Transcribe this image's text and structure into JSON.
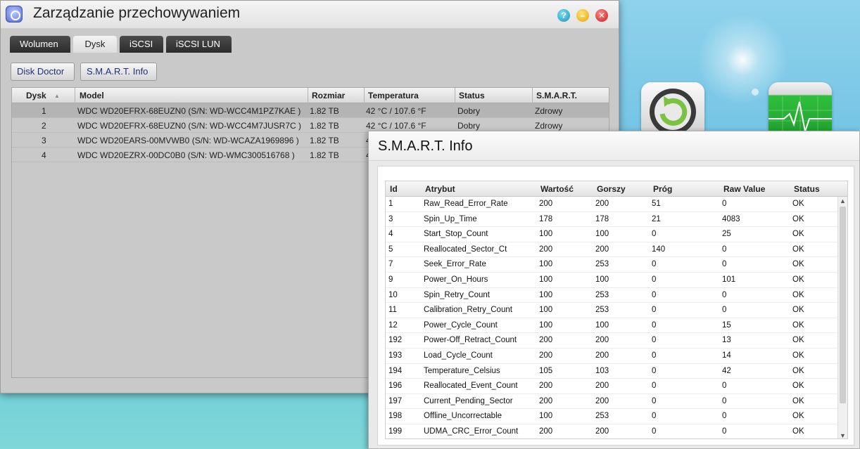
{
  "window": {
    "title": "Zarządzanie przechowywaniem",
    "help_icon": "question-icon",
    "minimize_icon": "minimize-icon",
    "close_icon": "close-icon"
  },
  "tabs": [
    {
      "label": "Wolumen"
    },
    {
      "label": "Dysk"
    },
    {
      "label": "iSCSI"
    },
    {
      "label": "iSCSI LUN"
    }
  ],
  "toolbar": {
    "disk_doctor": "Disk Doctor",
    "smart_info": "S.M.A.R.T. Info"
  },
  "disk_table": {
    "headers": [
      "Dysk",
      "Model",
      "Rozmiar",
      "Temperatura",
      "Status",
      "S.M.A.R.T."
    ],
    "sort_indicator": "▲",
    "rows": [
      {
        "disk": "1",
        "model": "WDC WD20EFRX-68EUZN0 (S/N: WD-WCC4M1PZ7KAE )",
        "size": "1.82 TB",
        "temp": "42 °C / 107.6 °F",
        "status": "Dobry",
        "smart": "Zdrowy"
      },
      {
        "disk": "2",
        "model": "WDC WD20EFRX-68EUZN0 (S/N: WD-WCC4M7JUSR7C )",
        "size": "1.82 TB",
        "temp": "42 °C / 107.6 °F",
        "status": "Dobry",
        "smart": "Zdrowy"
      },
      {
        "disk": "3",
        "model": "WDC WD20EARS-00MVWB0 (S/N: WD-WCAZA1969896 )",
        "size": "1.82 TB",
        "temp": "4",
        "status": "",
        "smart": ""
      },
      {
        "disk": "4",
        "model": "WDC WD20EZRX-00DC0B0 (S/N: WD-WMC300516768 )",
        "size": "1.82 TB",
        "temp": "4",
        "status": "",
        "smart": ""
      }
    ]
  },
  "smart_dialog": {
    "title": "S.M.A.R.T. Info",
    "headers": [
      "Id",
      "Atrybut",
      "Wartość",
      "Gorszy",
      "Próg",
      "Raw Value",
      "Status"
    ],
    "rows": [
      {
        "id": "1",
        "attr": "Raw_Read_Error_Rate",
        "value": "200",
        "worst": "200",
        "thresh": "51",
        "raw": "0",
        "status": "OK"
      },
      {
        "id": "3",
        "attr": "Spin_Up_Time",
        "value": "178",
        "worst": "178",
        "thresh": "21",
        "raw": "4083",
        "status": "OK"
      },
      {
        "id": "4",
        "attr": "Start_Stop_Count",
        "value": "100",
        "worst": "100",
        "thresh": "0",
        "raw": "25",
        "status": "OK"
      },
      {
        "id": "5",
        "attr": "Reallocated_Sector_Ct",
        "value": "200",
        "worst": "200",
        "thresh": "140",
        "raw": "0",
        "status": "OK"
      },
      {
        "id": "7",
        "attr": "Seek_Error_Rate",
        "value": "100",
        "worst": "253",
        "thresh": "0",
        "raw": "0",
        "status": "OK"
      },
      {
        "id": "9",
        "attr": "Power_On_Hours",
        "value": "100",
        "worst": "100",
        "thresh": "0",
        "raw": "101",
        "status": "OK"
      },
      {
        "id": "10",
        "attr": "Spin_Retry_Count",
        "value": "100",
        "worst": "253",
        "thresh": "0",
        "raw": "0",
        "status": "OK"
      },
      {
        "id": "11",
        "attr": "Calibration_Retry_Count",
        "value": "100",
        "worst": "253",
        "thresh": "0",
        "raw": "0",
        "status": "OK"
      },
      {
        "id": "12",
        "attr": "Power_Cycle_Count",
        "value": "100",
        "worst": "100",
        "thresh": "0",
        "raw": "15",
        "status": "OK"
      },
      {
        "id": "192",
        "attr": "Power-Off_Retract_Count",
        "value": "200",
        "worst": "200",
        "thresh": "0",
        "raw": "13",
        "status": "OK"
      },
      {
        "id": "193",
        "attr": "Load_Cycle_Count",
        "value": "200",
        "worst": "200",
        "thresh": "0",
        "raw": "14",
        "status": "OK"
      },
      {
        "id": "194",
        "attr": "Temperature_Celsius",
        "value": "105",
        "worst": "103",
        "thresh": "0",
        "raw": "42",
        "status": "OK"
      },
      {
        "id": "196",
        "attr": "Reallocated_Event_Count",
        "value": "200",
        "worst": "200",
        "thresh": "0",
        "raw": "0",
        "status": "OK"
      },
      {
        "id": "197",
        "attr": "Current_Pending_Sector",
        "value": "200",
        "worst": "200",
        "thresh": "0",
        "raw": "0",
        "status": "OK"
      },
      {
        "id": "198",
        "attr": "Offline_Uncorrectable",
        "value": "100",
        "worst": "253",
        "thresh": "0",
        "raw": "0",
        "status": "OK"
      },
      {
        "id": "199",
        "attr": "UDMA_CRC_Error_Count",
        "value": "200",
        "worst": "200",
        "thresh": "0",
        "raw": "0",
        "status": "OK"
      }
    ]
  },
  "desktop_icons": [
    {
      "icon": "backup-restore-icon"
    },
    {
      "icon": "resource-monitor-icon"
    }
  ],
  "colors": {
    "accent_text": "#20307a",
    "window_bg": "#c9c9c9",
    "close": "#d01818",
    "minimize": "#e0a800",
    "help": "#1892b7"
  }
}
